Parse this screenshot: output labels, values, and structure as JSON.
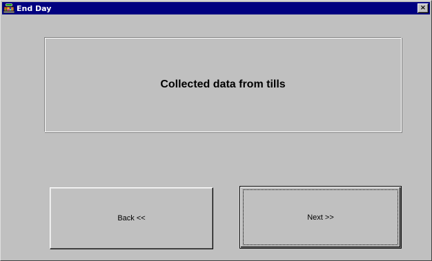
{
  "window": {
    "title": "End Day",
    "icon": "cash-register-icon",
    "close_label": "×"
  },
  "panel": {
    "message": "Collected data from tills"
  },
  "buttons": {
    "back_label": "Back <<",
    "next_label": "Next >>"
  },
  "colors": {
    "titlebar": "#000080",
    "face": "#c0c0c0"
  }
}
